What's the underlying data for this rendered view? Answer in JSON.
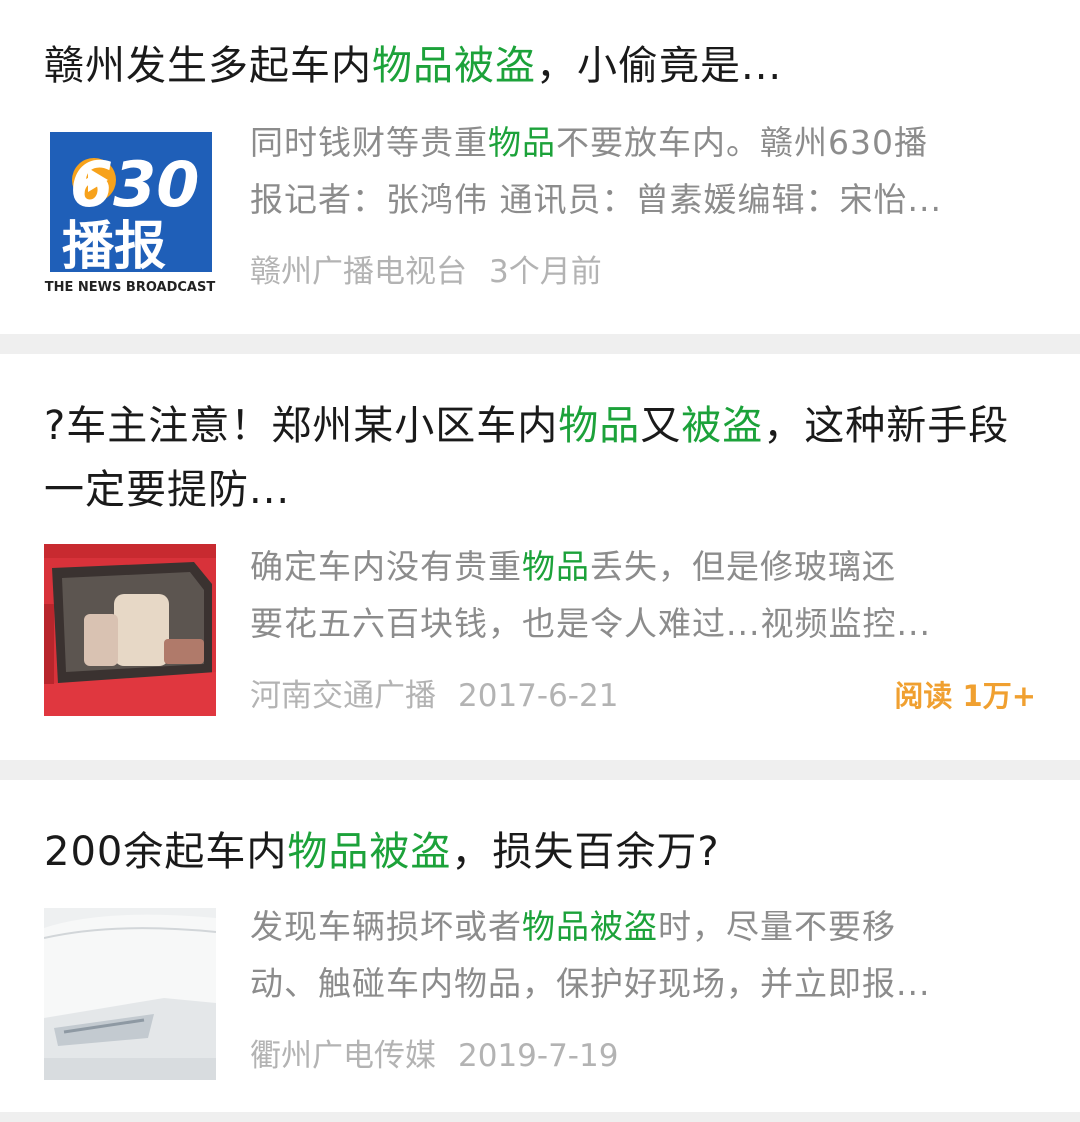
{
  "results": [
    {
      "title": [
        "赣州发生多起车内",
        "物品被盗",
        "，小偷竟是..."
      ],
      "title_hl": [
        false,
        true,
        false
      ],
      "snippet_line1": [
        "同时钱财等贵重",
        "物品",
        "不要放车内。赣州630播"
      ],
      "snippet_line1_hl": [
        false,
        true,
        false
      ],
      "snippet_line2": "报记者：张鸿伟 通讯员：曾素媛编辑：宋怡...",
      "thumb_text_top": "630",
      "thumb_text_mid": "播报",
      "thumb_text_bottom": "THE NEWS BROADCAST",
      "source": "赣州广播电视台",
      "time": "3个月前"
    },
    {
      "title": [
        "?车主注意！郑州某小区车内",
        "物品",
        "又",
        "被盗",
        "，这种新手段一定要提防..."
      ],
      "title_hl": [
        false,
        true,
        false,
        true,
        false
      ],
      "snippet_line1": [
        "确定车内没有贵重",
        "物品",
        "丢失，但是修玻璃还"
      ],
      "snippet_line1_hl": [
        false,
        true,
        false
      ],
      "snippet_line2": "要花五六百块钱，也是令人难过...视频监控...",
      "source": "河南交通广播",
      "time": "2017-6-21",
      "reads": "阅读 1万+"
    },
    {
      "title": [
        "200余起车内",
        "物品被盗",
        "，损失百余万?"
      ],
      "title_hl": [
        false,
        true,
        false
      ],
      "snippet_line1": [
        "发现车辆损坏或者",
        "物品被盗",
        "时，尽量不要移"
      ],
      "snippet_line1_hl": [
        false,
        true,
        false
      ],
      "snippet_line2": "动、触碰车内物品，保护好现场，并立即报...",
      "source": "衢州广电传媒",
      "time": "2019-7-19"
    }
  ],
  "colors": {
    "highlight": "#1ca23a",
    "reads": "#f0a030",
    "logo_blue": "#1f5fb8"
  }
}
